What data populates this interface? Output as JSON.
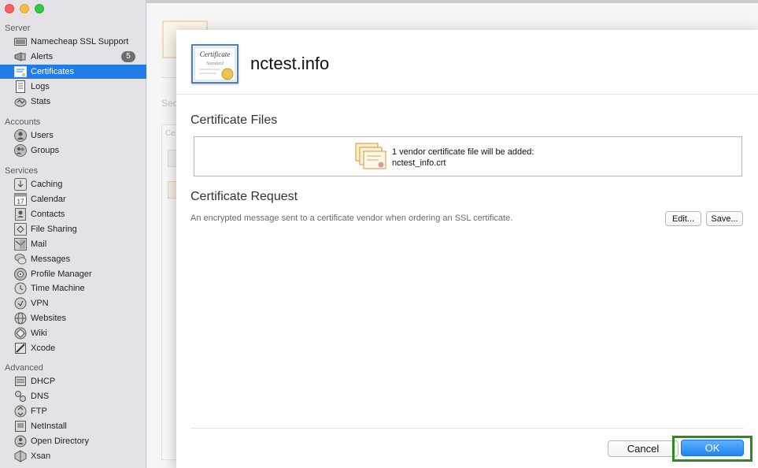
{
  "sidebar": {
    "sections": [
      {
        "header": "Server",
        "items": [
          {
            "label": "Namecheap SSL Support",
            "icon": "server-icon"
          },
          {
            "label": "Alerts",
            "icon": "megaphone-icon",
            "badge": "5"
          },
          {
            "label": "Certificates",
            "icon": "certificate-icon",
            "selected": true
          },
          {
            "label": "Logs",
            "icon": "document-icon"
          },
          {
            "label": "Stats",
            "icon": "stats-icon"
          }
        ]
      },
      {
        "header": "Accounts",
        "items": [
          {
            "label": "Users",
            "icon": "user-icon"
          },
          {
            "label": "Groups",
            "icon": "group-icon"
          }
        ]
      },
      {
        "header": "Services",
        "items": [
          {
            "label": "Caching",
            "icon": "caching-icon"
          },
          {
            "label": "Calendar",
            "icon": "calendar-icon",
            "glyph": "17"
          },
          {
            "label": "Contacts",
            "icon": "contacts-icon"
          },
          {
            "label": "File Sharing",
            "icon": "file-sharing-icon"
          },
          {
            "label": "Mail",
            "icon": "mail-icon"
          },
          {
            "label": "Messages",
            "icon": "messages-icon"
          },
          {
            "label": "Profile Manager",
            "icon": "profile-manager-icon"
          },
          {
            "label": "Time Machine",
            "icon": "time-machine-icon"
          },
          {
            "label": "VPN",
            "icon": "vpn-icon"
          },
          {
            "label": "Websites",
            "icon": "globe-icon"
          },
          {
            "label": "Wiki",
            "icon": "wiki-icon"
          },
          {
            "label": "Xcode",
            "icon": "xcode-icon"
          }
        ]
      },
      {
        "header": "Advanced",
        "items": [
          {
            "label": "DHCP",
            "icon": "dhcp-icon"
          },
          {
            "label": "DNS",
            "icon": "dns-icon"
          },
          {
            "label": "FTP",
            "icon": "ftp-icon"
          },
          {
            "label": "NetInstall",
            "icon": "netinstall-icon"
          },
          {
            "label": "Open Directory",
            "icon": "open-directory-icon"
          },
          {
            "label": "Xsan",
            "icon": "xsan-icon"
          }
        ]
      }
    ]
  },
  "background": {
    "section_partial": "Sec",
    "panel_partial": "Ce"
  },
  "sheet": {
    "title": "nctest.info",
    "cert_icon_text_1": "Certificate",
    "cert_icon_text_2": "Standard",
    "files_section_title": "Certificate Files",
    "files_line1": "1 vendor certificate file will be added:",
    "files_line2": "nctest_info.crt",
    "request_section_title": "Certificate Request",
    "request_description": "An encrypted message sent to a certificate vendor when ordering an SSL certificate.",
    "edit_label": "Edit...",
    "save_label": "Save...",
    "cancel_label": "Cancel",
    "ok_label": "OK"
  },
  "colors": {
    "selection": "#1f7ce8",
    "ok_button": "#1f86f2",
    "highlight_outline": "#2d8a1e"
  }
}
